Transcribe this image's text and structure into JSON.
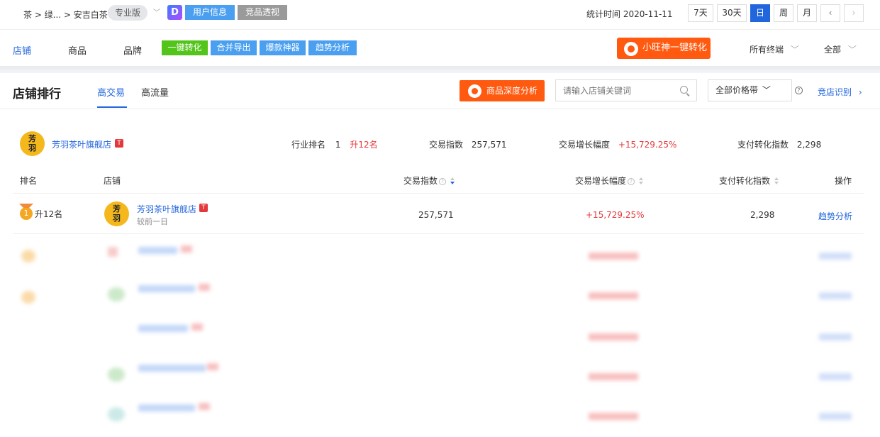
{
  "header": {
    "breadcrumb": "茶 > 绿... > 安吉白茶",
    "edition": "专业版",
    "btn_user_info": "用户信息",
    "btn_competitor": "竞品透视",
    "stat_time": "统计时间 2020-11-11",
    "periods": [
      "7天",
      "30天",
      "日",
      "周",
      "月"
    ],
    "active_period": "日"
  },
  "nav": {
    "tabs": [
      "店铺",
      "商品",
      "品牌"
    ],
    "active_tab": "店铺",
    "tool_buttons": [
      {
        "label": "一键转化",
        "color": "#52c41a"
      },
      {
        "label": "合并导出",
        "color": "#4a9ff0"
      },
      {
        "label": "爆款神器",
        "color": "#4a9ff0"
      },
      {
        "label": "趋势分析",
        "color": "#4a9ff0"
      }
    ],
    "xiaowang_button": "小旺神一键转化",
    "terminal_filter": "所有终端",
    "scope_filter": "全部"
  },
  "section": {
    "title": "店铺排行",
    "sub_tabs": [
      "高交易",
      "高流量"
    ],
    "active_sub_tab": "高交易",
    "deep_analysis_button": "商品深度分析",
    "search_placeholder": "请输入店铺关键词",
    "price_filter": "全部价格带",
    "identify_link": "竞店识别"
  },
  "summary": {
    "logo_text": [
      "芳",
      "羽"
    ],
    "shop_name": "芳羽茶叶旗舰店",
    "industry_rank_label": "行业排名",
    "industry_rank_value": "1",
    "industry_rank_change": "升12名",
    "trade_index_label": "交易指数",
    "trade_index_value": "257,571",
    "trade_growth_label": "交易增长幅度",
    "trade_growth_value": "+15,729.25%",
    "pay_conv_label": "支付转化指数",
    "pay_conv_value": "2,298"
  },
  "table": {
    "headers": {
      "rank": "排名",
      "shop": "店铺",
      "trade_index": "交易指数",
      "trade_growth": "交易增长幅度",
      "pay_conv": "支付转化指数",
      "action": "操作"
    },
    "rows": [
      {
        "rank": "1",
        "rank_change": "升12名",
        "logo_text": [
          "芳",
          "羽"
        ],
        "shop_name": "芳羽茶叶旗舰店",
        "compare_note": "较前一日",
        "trade_index": "257,571",
        "trade_growth": "+15,729.25%",
        "pay_conv": "2,298",
        "action": "趋势分析"
      }
    ]
  },
  "colors": {
    "accent_blue": "#2266dd",
    "orange": "#ff5a10",
    "red": "#e4393c",
    "gold": "#f4b81c"
  }
}
